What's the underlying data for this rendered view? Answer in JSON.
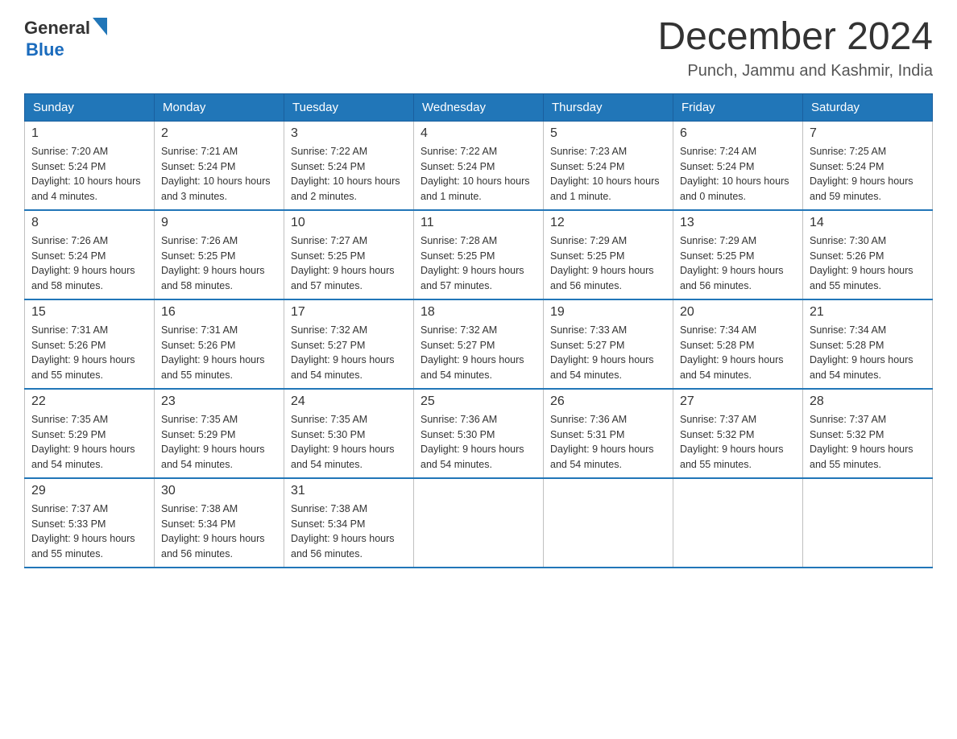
{
  "header": {
    "logo": {
      "general": "General",
      "blue": "Blue"
    },
    "title": "December 2024",
    "subtitle": "Punch, Jammu and Kashmir, India"
  },
  "days_of_week": [
    "Sunday",
    "Monday",
    "Tuesday",
    "Wednesday",
    "Thursday",
    "Friday",
    "Saturday"
  ],
  "weeks": [
    [
      {
        "day": "1",
        "sunrise": "7:20 AM",
        "sunset": "5:24 PM",
        "daylight": "10 hours and 4 minutes."
      },
      {
        "day": "2",
        "sunrise": "7:21 AM",
        "sunset": "5:24 PM",
        "daylight": "10 hours and 3 minutes."
      },
      {
        "day": "3",
        "sunrise": "7:22 AM",
        "sunset": "5:24 PM",
        "daylight": "10 hours and 2 minutes."
      },
      {
        "day": "4",
        "sunrise": "7:22 AM",
        "sunset": "5:24 PM",
        "daylight": "10 hours and 1 minute."
      },
      {
        "day": "5",
        "sunrise": "7:23 AM",
        "sunset": "5:24 PM",
        "daylight": "10 hours and 1 minute."
      },
      {
        "day": "6",
        "sunrise": "7:24 AM",
        "sunset": "5:24 PM",
        "daylight": "10 hours and 0 minutes."
      },
      {
        "day": "7",
        "sunrise": "7:25 AM",
        "sunset": "5:24 PM",
        "daylight": "9 hours and 59 minutes."
      }
    ],
    [
      {
        "day": "8",
        "sunrise": "7:26 AM",
        "sunset": "5:24 PM",
        "daylight": "9 hours and 58 minutes."
      },
      {
        "day": "9",
        "sunrise": "7:26 AM",
        "sunset": "5:25 PM",
        "daylight": "9 hours and 58 minutes."
      },
      {
        "day": "10",
        "sunrise": "7:27 AM",
        "sunset": "5:25 PM",
        "daylight": "9 hours and 57 minutes."
      },
      {
        "day": "11",
        "sunrise": "7:28 AM",
        "sunset": "5:25 PM",
        "daylight": "9 hours and 57 minutes."
      },
      {
        "day": "12",
        "sunrise": "7:29 AM",
        "sunset": "5:25 PM",
        "daylight": "9 hours and 56 minutes."
      },
      {
        "day": "13",
        "sunrise": "7:29 AM",
        "sunset": "5:25 PM",
        "daylight": "9 hours and 56 minutes."
      },
      {
        "day": "14",
        "sunrise": "7:30 AM",
        "sunset": "5:26 PM",
        "daylight": "9 hours and 55 minutes."
      }
    ],
    [
      {
        "day": "15",
        "sunrise": "7:31 AM",
        "sunset": "5:26 PM",
        "daylight": "9 hours and 55 minutes."
      },
      {
        "day": "16",
        "sunrise": "7:31 AM",
        "sunset": "5:26 PM",
        "daylight": "9 hours and 55 minutes."
      },
      {
        "day": "17",
        "sunrise": "7:32 AM",
        "sunset": "5:27 PM",
        "daylight": "9 hours and 54 minutes."
      },
      {
        "day": "18",
        "sunrise": "7:32 AM",
        "sunset": "5:27 PM",
        "daylight": "9 hours and 54 minutes."
      },
      {
        "day": "19",
        "sunrise": "7:33 AM",
        "sunset": "5:27 PM",
        "daylight": "9 hours and 54 minutes."
      },
      {
        "day": "20",
        "sunrise": "7:34 AM",
        "sunset": "5:28 PM",
        "daylight": "9 hours and 54 minutes."
      },
      {
        "day": "21",
        "sunrise": "7:34 AM",
        "sunset": "5:28 PM",
        "daylight": "9 hours and 54 minutes."
      }
    ],
    [
      {
        "day": "22",
        "sunrise": "7:35 AM",
        "sunset": "5:29 PM",
        "daylight": "9 hours and 54 minutes."
      },
      {
        "day": "23",
        "sunrise": "7:35 AM",
        "sunset": "5:29 PM",
        "daylight": "9 hours and 54 minutes."
      },
      {
        "day": "24",
        "sunrise": "7:35 AM",
        "sunset": "5:30 PM",
        "daylight": "9 hours and 54 minutes."
      },
      {
        "day": "25",
        "sunrise": "7:36 AM",
        "sunset": "5:30 PM",
        "daylight": "9 hours and 54 minutes."
      },
      {
        "day": "26",
        "sunrise": "7:36 AM",
        "sunset": "5:31 PM",
        "daylight": "9 hours and 54 minutes."
      },
      {
        "day": "27",
        "sunrise": "7:37 AM",
        "sunset": "5:32 PM",
        "daylight": "9 hours and 55 minutes."
      },
      {
        "day": "28",
        "sunrise": "7:37 AM",
        "sunset": "5:32 PM",
        "daylight": "9 hours and 55 minutes."
      }
    ],
    [
      {
        "day": "29",
        "sunrise": "7:37 AM",
        "sunset": "5:33 PM",
        "daylight": "9 hours and 55 minutes."
      },
      {
        "day": "30",
        "sunrise": "7:38 AM",
        "sunset": "5:34 PM",
        "daylight": "9 hours and 56 minutes."
      },
      {
        "day": "31",
        "sunrise": "7:38 AM",
        "sunset": "5:34 PM",
        "daylight": "9 hours and 56 minutes."
      },
      null,
      null,
      null,
      null
    ]
  ],
  "labels": {
    "sunrise": "Sunrise:",
    "sunset": "Sunset:",
    "daylight": "Daylight:"
  }
}
